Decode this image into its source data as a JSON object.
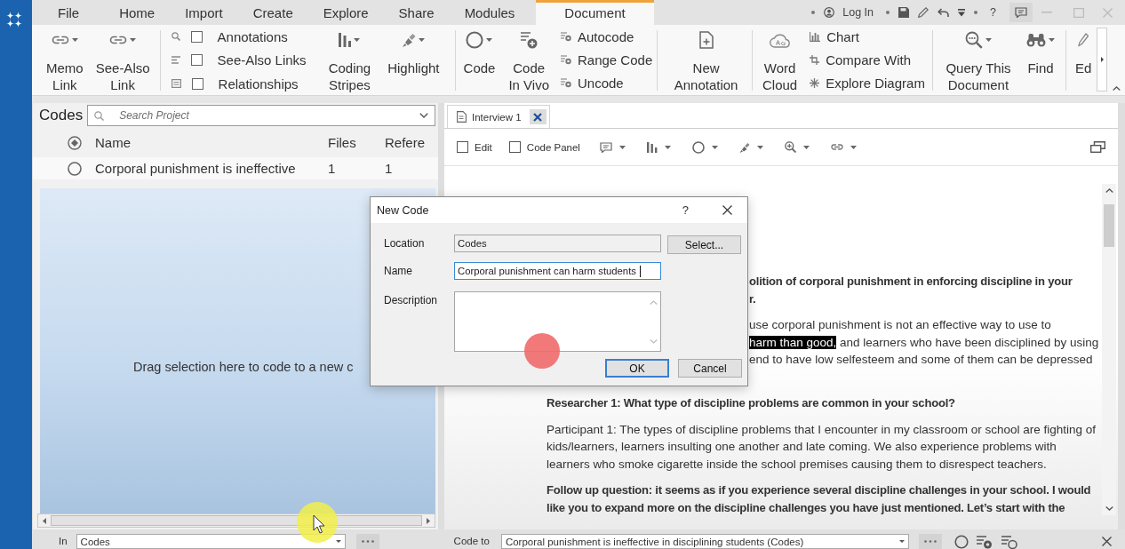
{
  "menu_tabs": [
    {
      "label": "File",
      "selected": false
    },
    {
      "label": "Home",
      "selected": false
    },
    {
      "label": "Import",
      "selected": false
    },
    {
      "label": "Create",
      "selected": false
    },
    {
      "label": "Explore",
      "selected": false
    },
    {
      "label": "Share",
      "selected": false
    },
    {
      "label": "Modules",
      "selected": false
    },
    {
      "label": "Document",
      "selected": true
    }
  ],
  "title_bar": {
    "login": "Log In",
    "help": "?"
  },
  "ribbon": [
    {
      "items": [
        {
          "kind": "large",
          "label": "Memo\nLink",
          "dropdown": true
        },
        {
          "kind": "large",
          "label": "See-Also\nLink",
          "dropdown": true
        }
      ]
    },
    {
      "items": [
        {
          "kind": "check",
          "label": "Annotations",
          "checked": false
        },
        {
          "kind": "check",
          "label": "See-Also Links",
          "checked": false
        },
        {
          "kind": "check",
          "label": "Relationships",
          "checked": false
        },
        {
          "kind": "large",
          "label": "Coding\nStripes",
          "dropdown": true
        },
        {
          "kind": "large",
          "label": "Highlight",
          "dropdown": true
        }
      ]
    },
    {
      "items": [
        {
          "kind": "large",
          "label": "Code",
          "dropdown": true
        },
        {
          "kind": "large",
          "label": "Code\nIn Vivo",
          "dropdown": false
        },
        {
          "kind": "small",
          "label": "Autocode"
        },
        {
          "kind": "small",
          "label": "Range Code"
        },
        {
          "kind": "small",
          "label": "Uncode"
        }
      ]
    },
    {
      "items": [
        {
          "kind": "large",
          "label": "New\nAnnotation",
          "dropdown": false
        }
      ]
    },
    {
      "items": [
        {
          "kind": "large",
          "label": "Word\nCloud",
          "dropdown": false
        },
        {
          "kind": "small",
          "label": "Chart"
        },
        {
          "kind": "small",
          "label": "Compare With"
        },
        {
          "kind": "small",
          "label": "Explore Diagram"
        }
      ]
    },
    {
      "items": [
        {
          "kind": "large",
          "label": "Query This\nDocument",
          "dropdown": true
        },
        {
          "kind": "large",
          "label": "Find",
          "dropdown": true
        }
      ]
    },
    {
      "items": [
        {
          "kind": "large",
          "label": "Ed",
          "dropdown": false
        }
      ]
    }
  ],
  "codes_panel": {
    "title": "Codes",
    "search": {
      "placeholder": "Search Project"
    },
    "columns": [
      "Name",
      "Files",
      "Refere"
    ],
    "rows": [
      {
        "name": "Corporal punishment is ineffective",
        "files": "1",
        "references": "1"
      }
    ],
    "drop_hint": "Drag selection here to code to a new c"
  },
  "document": {
    "tabs": [
      {
        "label": "Interview 1",
        "selected": true
      }
    ],
    "toolbar": [
      {
        "label": "Edit",
        "checked": false
      },
      {
        "label": "Code Panel",
        "checked": false
      }
    ],
    "paragraphs": [
      {
        "kind": "question",
        "covered": true,
        "lines": [
          [
            {
              "text": "olition of corporal punishment in enforcing discipline in your",
              "selected": false
            }
          ],
          [
            {
              "text": "r.",
              "selected": false
            }
          ]
        ]
      },
      {
        "kind": "answer",
        "covered": true,
        "lines": [
          [
            {
              "text": "use corporal punishment is not an effective way to use to",
              "selected": false
            }
          ],
          [
            {
              "text": "harm than good,",
              "selected": true
            },
            {
              "text": " and learners who have been disciplined by using",
              "selected": false
            }
          ],
          [
            {
              "text": "end to have low selfesteem and some of them can be depressed",
              "selected": false
            }
          ]
        ]
      },
      {
        "kind": "question",
        "covered": false,
        "lines": [
          [
            {
              "text": "Researcher 1: What type of discipline problems are common in your school?",
              "selected": false
            }
          ]
        ]
      },
      {
        "kind": "answer",
        "covered": false,
        "lines": [
          [
            {
              "text": "Participant 1: The types of discipline problems that I encounter in my classroom or school are fighting of",
              "selected": false
            }
          ],
          [
            {
              "text": "kids/learners, learners insulting one another and late coming. We also experience problems with",
              "selected": false
            }
          ],
          [
            {
              "text": "learners who smoke cigarette inside the school premises causing them to disrespect teachers.",
              "selected": false
            }
          ]
        ]
      },
      {
        "kind": "question",
        "covered": false,
        "lines": [
          [
            {
              "text": "Follow up question: it seems as if you experience several discipline challenges in your school. I would",
              "selected": false
            }
          ],
          [
            {
              "text": "like you to expand more on the discipline challenges you have just mentioned. Let’s start with the",
              "selected": false
            }
          ]
        ]
      }
    ]
  },
  "dialog": {
    "title": "New Code",
    "help": "?",
    "fields": [
      {
        "kind": "readonly",
        "label": "Location",
        "value": "Codes",
        "button": "Select..."
      },
      {
        "kind": "text",
        "label": "Name",
        "value": "Corporal punishment can harm students",
        "focused": true
      },
      {
        "kind": "multiline",
        "label": "Description"
      }
    ],
    "buttons": [
      {
        "label": "OK",
        "default": true
      },
      {
        "label": "Cancel",
        "default": false
      }
    ]
  },
  "bottom_bar": {
    "scope": {
      "label": "In",
      "value": "Codes"
    },
    "code_to": {
      "label": "Code to",
      "value": "Corporal punishment is ineffective in disciplining students (Codes)"
    }
  }
}
